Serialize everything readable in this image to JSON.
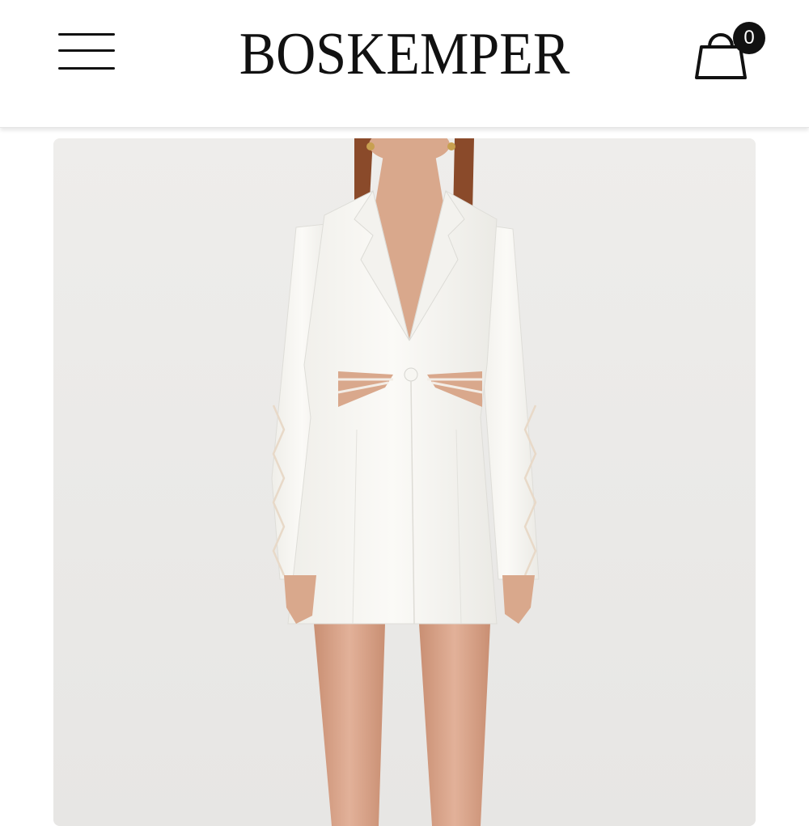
{
  "header": {
    "brand": "BOSKEMPER",
    "menu_icon": "hamburger-menu-icon",
    "cart": {
      "icon": "shopping-bag-icon",
      "count": "0"
    }
  },
  "product": {
    "image_description_icon": "product-photo",
    "colors": {
      "background": "#ecebea",
      "garment": "#f7f6f2",
      "hair": "#8a4a2a",
      "skin": "#d9a88c"
    }
  }
}
